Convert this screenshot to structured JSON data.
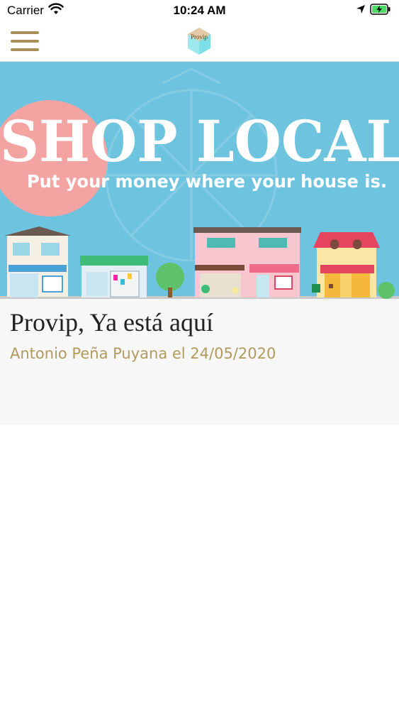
{
  "status_bar": {
    "carrier": "Carrier",
    "time": "10:24 AM"
  },
  "header": {
    "logo_text": "Provip"
  },
  "hero": {
    "headline": "SHOP LOCAL",
    "tagline": "Put your money where your house is."
  },
  "article": {
    "title": "Provip, Ya está aquí",
    "meta": "Antonio Peña Puyana el 24/05/2020"
  },
  "colors": {
    "accent": "#b09a5e",
    "hamburger": "#a88f5a",
    "hero_sky": "#6ec3df",
    "hero_circle": "#f4a3a3",
    "card_bg": "#f7f7f7"
  }
}
